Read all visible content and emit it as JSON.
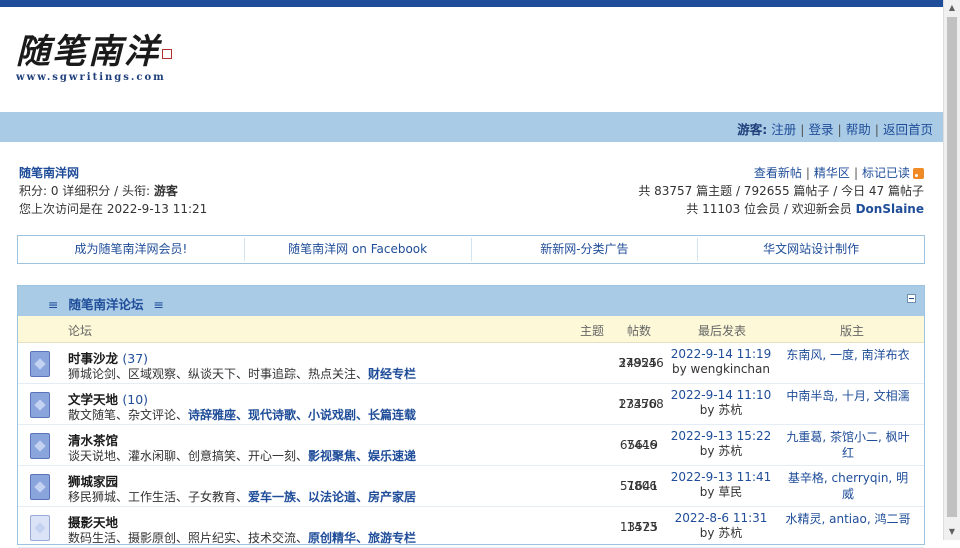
{
  "logo": {
    "title": "随笔南洋",
    "url": "www.sgwritings.com"
  },
  "nav": {
    "guest_label": "游客:",
    "links": [
      "注册",
      "登录",
      "帮助",
      "返回首页"
    ]
  },
  "info_left": {
    "site_name": "随笔南洋网",
    "line2": "积分: 0 详细积分 / 头衔: ",
    "title_value": "游客",
    "line3": "您上次访问是在 2022-9-13 11:21"
  },
  "info_right": {
    "links": [
      "查看新帖",
      "精华区",
      "标记已读"
    ],
    "stats": "共 83757 篇主题 / 792655 篇帖子 / 今日 47 篇帖子",
    "members": "共 11103 位会员 / 欢迎新会员 ",
    "new_member": "DonSlaine"
  },
  "promo_links": [
    "成为随笔南洋网会员!",
    "随笔南洋网 on Facebook",
    "新新网-分类广告",
    "华文网站设计制作"
  ],
  "forum": {
    "section_title": "随笔南洋论坛",
    "section_eq": "≡",
    "columns": {
      "forum": "论坛",
      "topics": "主题",
      "posts": "帖数",
      "last": "最后发表",
      "mods": "版主"
    },
    "rows": [
      {
        "name": "时事沙龙",
        "count": "(37)",
        "sub_plain": "狮城论剑、区域观察、纵谈天下、时事追踪、热点关注、",
        "sub_links": "财经专栏",
        "topics": "24925",
        "posts": "378546",
        "last_time": "2022-9-14 11:19",
        "last_by": "by wengkinchan",
        "mods": "东南风, 一度, 南洋布衣"
      },
      {
        "name": "文学天地",
        "count": "(10)",
        "sub_plain": "散文随笔、杂文评论、",
        "sub_links": "诗辞雅座、现代诗歌、小说戏剧、长篇连载",
        "topics": "23470",
        "posts": "173568",
        "last_time": "2022-9-14 11:10",
        "last_by": "by 苏杭",
        "mods": "中南半岛, 十月, 文相濡"
      },
      {
        "name": "清水茶馆",
        "count": "",
        "sub_plain": "谈天说地、灌水闲聊、创意搞笑、开心一刻、",
        "sub_links": "影视聚焦、娱乐速递",
        "topics": "7446",
        "posts": "65619",
        "last_time": "2022-9-13 15:22",
        "last_by": "by 苏杭",
        "mods": "九重葛, 茶馆小二, 枫叶红"
      },
      {
        "name": "狮城家园",
        "count": "",
        "sub_plain": "移民狮城、工作生活、子女教育、",
        "sub_links": "爱车一族、以法论道、房产家居",
        "topics": "7806",
        "posts": "51641",
        "last_time": "2022-9-13 11:41",
        "last_by": "by 草民",
        "mods": "基辛格, cherryqin, 明威"
      },
      {
        "name": "摄影天地",
        "count": "",
        "sub_plain": "数码生活、摄影原创、照片纪实、技术交流、",
        "sub_links": "原创精华、旅游专栏",
        "topics": "1473",
        "posts": "13525",
        "last_time": "2022-8-6 11:31",
        "last_by": "by 苏杭",
        "mods": "水精灵, antiao, 鸿二哥"
      }
    ]
  }
}
